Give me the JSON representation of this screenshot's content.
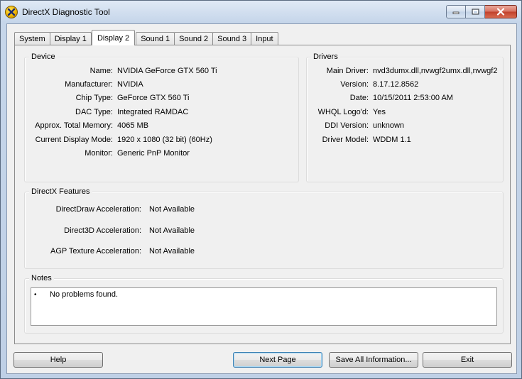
{
  "window": {
    "title": "DirectX Diagnostic Tool"
  },
  "tabs": [
    {
      "label": "System"
    },
    {
      "label": "Display 1"
    },
    {
      "label": "Display 2",
      "active": true
    },
    {
      "label": "Sound 1"
    },
    {
      "label": "Sound 2"
    },
    {
      "label": "Sound 3"
    },
    {
      "label": "Input"
    }
  ],
  "device": {
    "title": "Device",
    "rows": [
      {
        "label": "Name:",
        "value": "NVIDIA GeForce GTX 560 Ti"
      },
      {
        "label": "Manufacturer:",
        "value": "NVIDIA"
      },
      {
        "label": "Chip Type:",
        "value": "GeForce GTX 560 Ti"
      },
      {
        "label": "DAC Type:",
        "value": "Integrated RAMDAC"
      },
      {
        "label": "Approx. Total Memory:",
        "value": "4065 MB"
      },
      {
        "label": "Current Display Mode:",
        "value": "1920 x 1080 (32 bit) (60Hz)"
      },
      {
        "label": "Monitor:",
        "value": "Generic PnP Monitor"
      }
    ]
  },
  "drivers": {
    "title": "Drivers",
    "rows": [
      {
        "label": "Main Driver:",
        "value": "nvd3dumx.dll,nvwgf2umx.dll,nvwgf2"
      },
      {
        "label": "Version:",
        "value": "8.17.12.8562"
      },
      {
        "label": "Date:",
        "value": "10/15/2011 2:53:00 AM"
      },
      {
        "label": "WHQL Logo'd:",
        "value": "Yes"
      },
      {
        "label": "DDI Version:",
        "value": "unknown"
      },
      {
        "label": "Driver Model:",
        "value": "WDDM 1.1"
      }
    ]
  },
  "features": {
    "title": "DirectX Features",
    "rows": [
      {
        "label": "DirectDraw Acceleration:",
        "value": "Not Available"
      },
      {
        "label": "Direct3D Acceleration:",
        "value": "Not Available"
      },
      {
        "label": "AGP Texture Acceleration:",
        "value": "Not Available"
      }
    ]
  },
  "notes": {
    "title": "Notes",
    "bullet": "•",
    "items": [
      "No problems found."
    ]
  },
  "buttons": {
    "help": "Help",
    "next_page": "Next Page",
    "save_all": "Save All Information...",
    "exit": "Exit"
  },
  "icons": {
    "app": "directx-icon",
    "minimize": "minimize-icon",
    "maximize": "maximize-icon",
    "close": "close-icon"
  }
}
